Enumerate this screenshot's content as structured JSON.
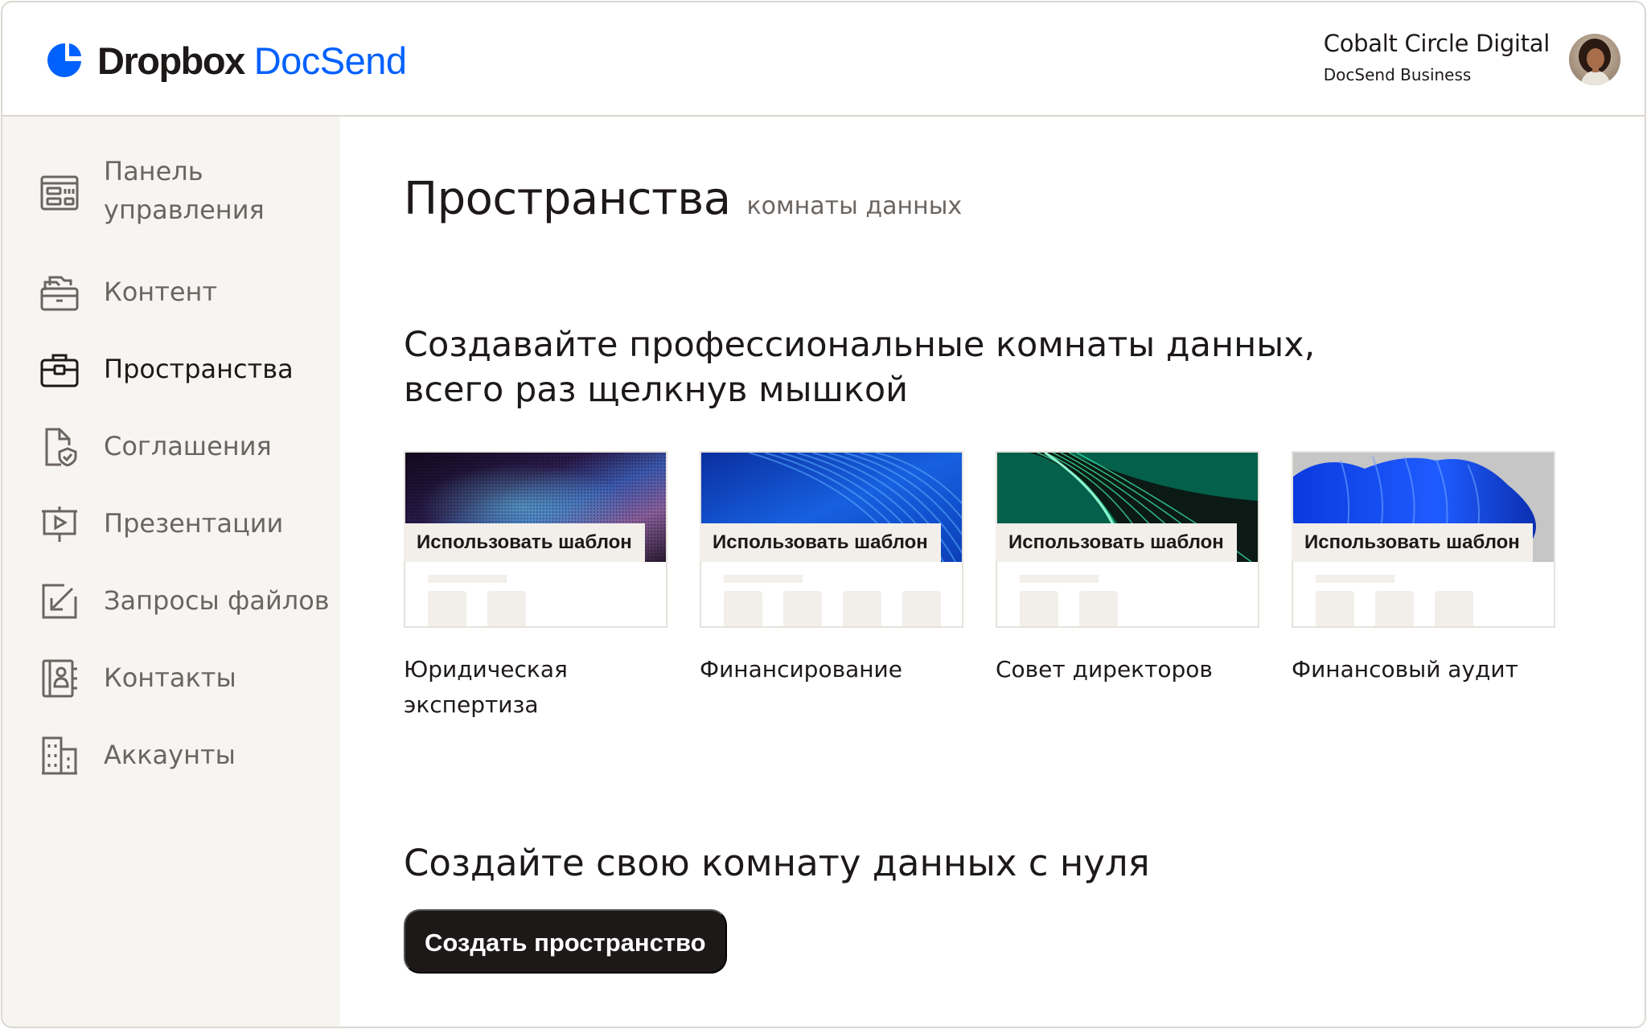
{
  "header": {
    "logo_dropbox": "Dropbox",
    "logo_docsend": "DocSend",
    "account_name": "Cobalt Circle Digital",
    "account_plan": "DocSend Business",
    "brand_color": "#0061fe"
  },
  "sidebar": {
    "items": [
      {
        "label": "Панель управления",
        "icon": "dashboard-icon",
        "active": false
      },
      {
        "label": "Контент",
        "icon": "content-folder-icon",
        "active": false
      },
      {
        "label": "Пространства",
        "icon": "briefcase-icon",
        "active": true
      },
      {
        "label": "Соглашения",
        "icon": "document-shield-icon",
        "active": false
      },
      {
        "label": "Презентации",
        "icon": "presentation-icon",
        "active": false
      },
      {
        "label": "Запросы файлов",
        "icon": "file-request-icon",
        "active": false
      },
      {
        "label": "Контакты",
        "icon": "contacts-icon",
        "active": false
      },
      {
        "label": "Аккаунты",
        "icon": "building-icon",
        "active": false
      }
    ]
  },
  "main": {
    "title": "Пространства",
    "subtitle": "комнаты данных",
    "templates_heading": "Создавайте профессиональные комнаты данных, всего раз щелкнув мышкой",
    "templates": [
      {
        "title": "Юридическая экспертиза",
        "button": "Использовать шаблон",
        "theme": "dark-holographic"
      },
      {
        "title": "Финансирование",
        "button": "Использовать шаблон",
        "theme": "blue-waves"
      },
      {
        "title": "Совет директоров",
        "button": "Использовать шаблон",
        "theme": "green-curves"
      },
      {
        "title": "Финансовый аудит",
        "button": "Использовать шаблон",
        "theme": "blue-ribbons-on-gray"
      }
    ],
    "scratch_heading": "Создайте свою комнату данных с нуля",
    "create_button": "Создать пространство"
  }
}
